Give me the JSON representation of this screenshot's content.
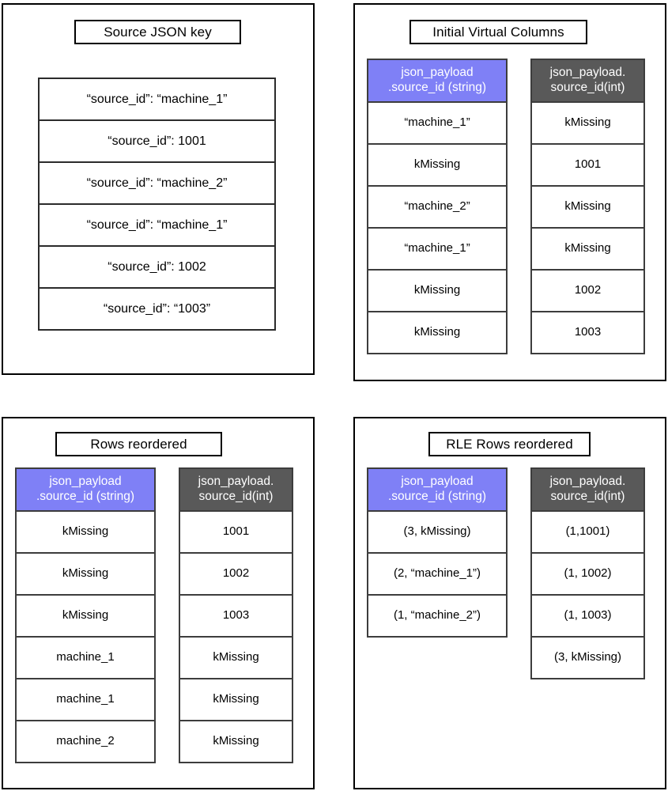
{
  "colors": {
    "string_header_bg": "#7f80f6",
    "int_header_bg": "#595959",
    "header_text": "#ffffff",
    "panel_border": "#000000",
    "cell_border": "#3d3d3d",
    "page_bg": "#ffffff"
  },
  "column_headers": {
    "string_line1": "json_payload",
    "string_line2": ".source_id (string)",
    "int_line1": "json_payload.",
    "int_line2": "source_id(int)"
  },
  "panels": {
    "source": {
      "title": "Source JSON key",
      "rows": [
        "“source_id”: “machine_1”",
        "“source_id”: 1001",
        "“source_id”: “machine_2”",
        "“source_id”: “machine_1”",
        "“source_id”: 1002",
        "“source_id”: “1003”"
      ]
    },
    "initial": {
      "title": "Initial Virtual Columns",
      "string_column": [
        "“machine_1”",
        "kMissing",
        "“machine_2”",
        "“machine_1”",
        "kMissing",
        "kMissing"
      ],
      "int_column": [
        "kMissing",
        "1001",
        "kMissing",
        "kMissing",
        "1002",
        "1003"
      ]
    },
    "reordered": {
      "title": "Rows reordered",
      "string_column": [
        "kMissing",
        "kMissing",
        "kMissing",
        "machine_1",
        "machine_1",
        "machine_2"
      ],
      "int_column": [
        "1001",
        "1002",
        "1003",
        "kMissing",
        "kMissing",
        "kMissing"
      ]
    },
    "rle": {
      "title": "RLE Rows reordered",
      "string_column": [
        "(3, kMissing)",
        "(2, “machine_1”)",
        "(1, “machine_2”)"
      ],
      "int_column": [
        "(1,1001)",
        "(1, 1002)",
        "(1, 1003)",
        "(3, kMissing)"
      ]
    }
  }
}
